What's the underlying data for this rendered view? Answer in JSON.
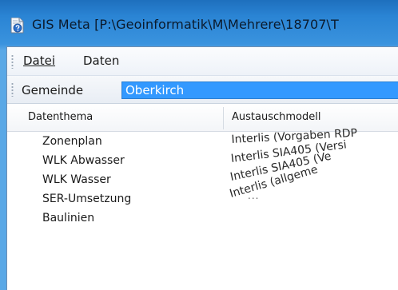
{
  "window": {
    "title": "GIS Meta [P:\\Geoinformatik\\M\\Mehrere\\18707\\T"
  },
  "menubar": {
    "items": [
      {
        "label": "Datei"
      },
      {
        "label": "Daten"
      }
    ]
  },
  "toolbar": {
    "gemeinde_label": "Gemeinde",
    "gemeinde_value": "Oberkirch"
  },
  "grid": {
    "columns": [
      "Datenthema",
      "Austauschmodell"
    ],
    "rows": [
      {
        "thema": "Zonenplan",
        "modell": "Interlis (Vorgaben RDP"
      },
      {
        "thema": "WLK Abwasser",
        "modell": "Interlis SIA405 (Versi"
      },
      {
        "thema": "WLK Wasser",
        "modell": "Interlis SIA405 (Ve"
      },
      {
        "thema": "SER-Umsetzung",
        "modell": "Interlis (allgeme"
      },
      {
        "thema": "Baulinien",
        "modell": ""
      }
    ],
    "ellipsis": "..."
  }
}
